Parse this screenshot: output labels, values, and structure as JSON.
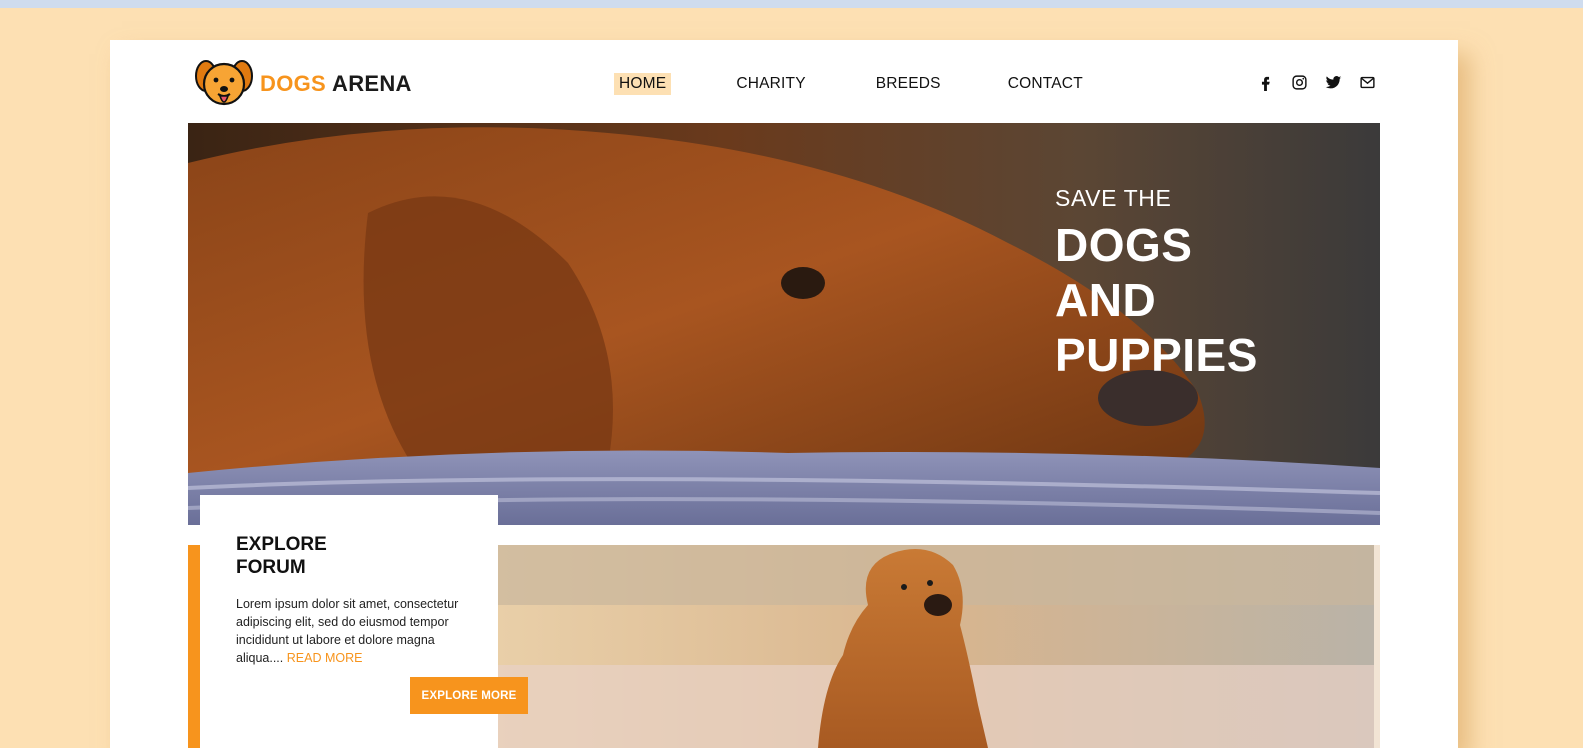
{
  "brand": {
    "name_part1": "DOGS",
    "name_part2": "ARENA",
    "logo_icon": "dog-face-icon"
  },
  "nav": {
    "items": [
      {
        "label": "HOME",
        "active": true
      },
      {
        "label": "CHARITY"
      },
      {
        "label": "BREEDS"
      },
      {
        "label": "CONTACT"
      }
    ]
  },
  "social": {
    "icons": [
      "facebook-icon",
      "instagram-icon",
      "twitter-icon",
      "mail-icon"
    ]
  },
  "hero": {
    "subtitle": "SAVE THE",
    "title_line1": "DOGS",
    "title_line2": "AND",
    "title_line3": "PUPPIES"
  },
  "forum": {
    "title_line1": "EXPLORE",
    "title_line2": "FORUM",
    "text": "Lorem ipsum dolor sit amet, consectetur adipiscing elit, sed do eiusmod tempor incididunt ut labore et dolore magna aliqua....",
    "read_more": "READ MORE",
    "button": "EXPLORE MORE"
  },
  "colors": {
    "accent": "#f7941d",
    "background": "#fde0b3",
    "active_nav": "#fde0b3"
  }
}
